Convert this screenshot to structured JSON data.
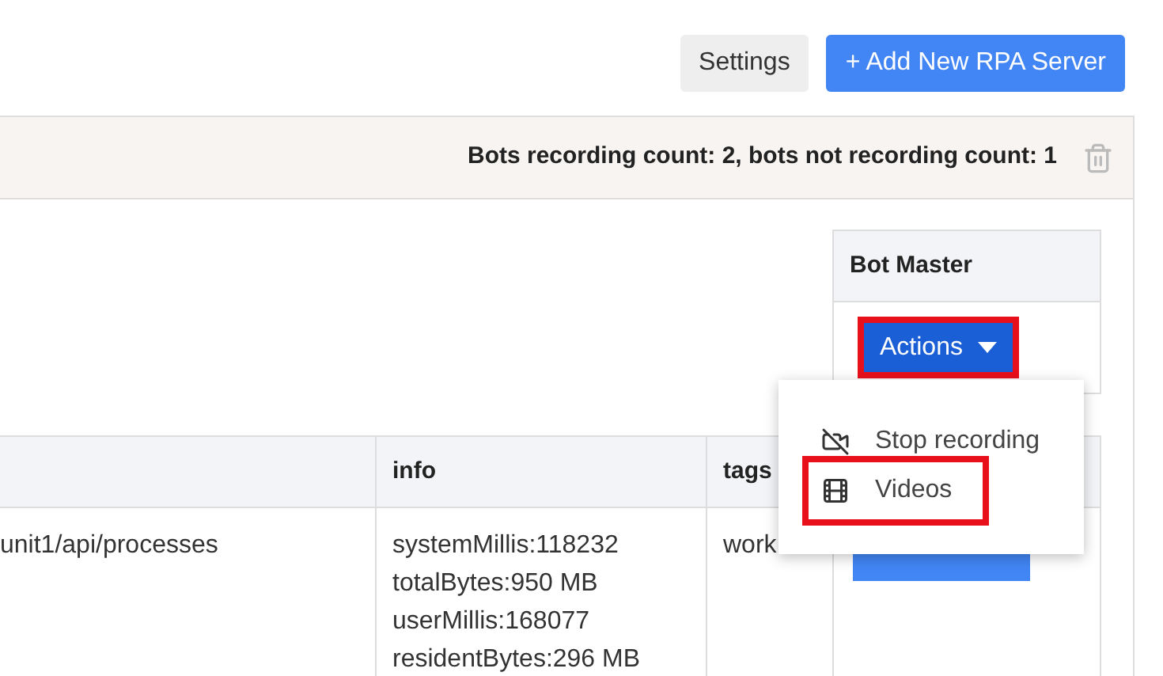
{
  "toolbar": {
    "buttons": [
      {
        "label": "Settings",
        "kind": "secondary"
      },
      {
        "label": "+ Add New RPA Server",
        "kind": "primary"
      }
    ]
  },
  "server_header": {
    "status": "Bots recording count: 2, bots not recording count: 1"
  },
  "bot_master": {
    "heading": "Bot Master",
    "button": "Actions",
    "highlighted": true
  },
  "table": {
    "columns": [
      "",
      "info",
      "tags",
      ""
    ],
    "rows": [
      {
        "url": "unit1/api/processes",
        "info": [
          "systemMillis:118232",
          "totalBytes:950 MB",
          "userMillis:168077",
          "residentBytes:296 MB"
        ],
        "tags": "work"
      }
    ]
  },
  "menu": {
    "items": [
      {
        "label": "Stop recording",
        "kind": "stop",
        "highlighted": false
      },
      {
        "label": "Videos",
        "kind": "videos",
        "highlighted": true
      }
    ]
  }
}
